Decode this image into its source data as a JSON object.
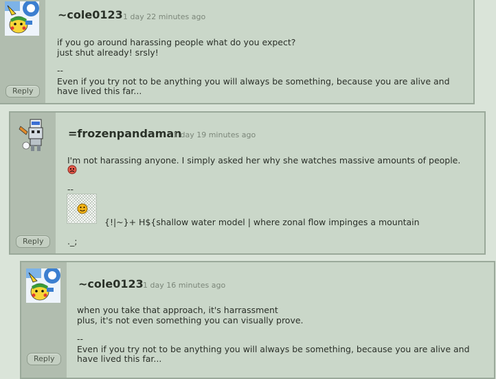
{
  "comments": [
    {
      "username": "~cole0123",
      "time": "1 day 22 minutes ago",
      "lines": [
        "if you go around harassing people what do you expect?",
        "just shut already! srsly!",
        "--",
        "Even if you try not to be anything you will always be something, because you are alive and",
        "have lived this far..."
      ],
      "reply_label": "Reply"
    },
    {
      "username": "=frozenpandaman",
      "time": "1 day 19 minutes ago",
      "lines": [
        "I'm not harassing anyone. I simply asked her why she watches massive amounts of people.",
        "--",
        "{!|~}+   H${shallow water model |  where zonal flow impinges a mountain",
        "._;"
      ],
      "reply_label": "Reply"
    },
    {
      "username": "~cole0123",
      "time": "1 day 16 minutes ago",
      "lines": [
        "when you take that approach, it's harrassment",
        "plus, it's not even something you can visually prove.",
        "--",
        "Even if you try not to be anything you will always be something, because you are alive and",
        "have lived this far..."
      ],
      "reply_label": "Reply"
    }
  ],
  "colors": {
    "page_bg": "#dae4d9",
    "panel_bg": "#cad7c9",
    "gutter_bg": "#b1bdaf",
    "border": "#9aa99a"
  },
  "icons": {
    "avatar_cole": "pikachu-avatar-icon",
    "avatar_frozen": "pixel-robot-avatar-icon",
    "emoticon_mad": "angry-face-icon",
    "emoticon_smile": "smiley-face-icon"
  }
}
